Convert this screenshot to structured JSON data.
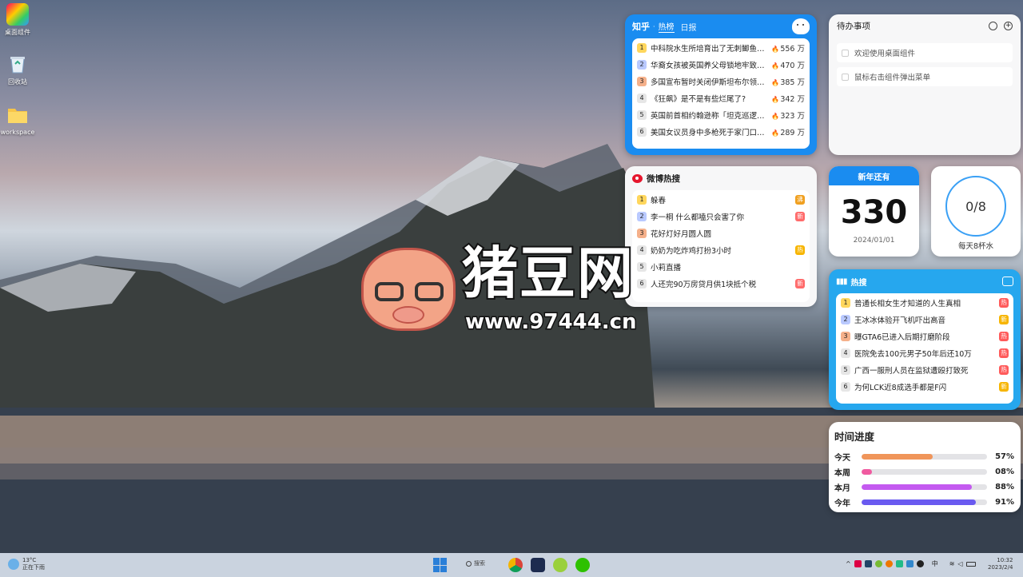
{
  "desktop": {
    "icons": [
      {
        "label": "桌面组件",
        "icon": "widget-app-icon"
      },
      {
        "label": "回收站",
        "icon": "recycle-bin-icon"
      },
      {
        "label": "workspace",
        "icon": "folder-icon"
      }
    ]
  },
  "zhihu": {
    "brand": "知乎",
    "tabs": [
      "热榜",
      "日报"
    ],
    "active_tab": "热榜",
    "items": [
      {
        "rank": "1",
        "title": "中科院水生所培育出了无刺鲫鱼，80...",
        "heat": "556 万"
      },
      {
        "rank": "2",
        "title": "华裔女孩被英国养父母锁地牢致役十...",
        "heat": "470 万"
      },
      {
        "rank": "3",
        "title": "多国宣布暂时关闭伊斯坦布尔领事馆...",
        "heat": "385 万"
      },
      {
        "rank": "4",
        "title": "《狂飙》是不是有些烂尾了?",
        "heat": "342 万"
      },
      {
        "rank": "5",
        "title": "英国前首相约翰逊称「坦克巡逻自己...",
        "heat": "323 万"
      },
      {
        "rank": "6",
        "title": "美国女议员身中多枪死于家门口，留...",
        "heat": "289 万"
      }
    ]
  },
  "todo": {
    "title": "待办事项",
    "items": [
      "欢迎使用桌面组件",
      "鼠标右击组件弹出菜单"
    ]
  },
  "weibo": {
    "title": "微博热搜",
    "items": [
      {
        "rank": "1",
        "title": "躲春",
        "tag": "沸",
        "tag_type": "fei"
      },
      {
        "rank": "2",
        "title": "李一桐 什么都嗑只会害了你",
        "tag": "新",
        "tag_type": "new"
      },
      {
        "rank": "3",
        "title": "花好灯好月圆人圆",
        "tag": "",
        "tag_type": ""
      },
      {
        "rank": "4",
        "title": "奶奶为吃炸鸡打扮3小时",
        "tag": "热",
        "tag_type": "jian"
      },
      {
        "rank": "5",
        "title": "小莉直播",
        "tag": "",
        "tag_type": ""
      },
      {
        "rank": "6",
        "title": "人还完90万房贷月供1块抵个税",
        "tag": "新",
        "tag_type": "new"
      }
    ]
  },
  "countdown": {
    "header": "新年还有",
    "days": "330",
    "date": "2024/01/01",
    "header_color": "#1a8cf0"
  },
  "water": {
    "value": "0/8",
    "caption": "每天8杯水",
    "ring_color": "#3aa0f5"
  },
  "douyin": {
    "title": "热搜",
    "items": [
      {
        "rank": "1",
        "title": "普通长相女生才知道的人生真相",
        "tag": "热",
        "tag_type": "hot"
      },
      {
        "rank": "2",
        "title": "王冰冰体验开飞机吓出高音",
        "tag": "新",
        "tag_type": "jian"
      },
      {
        "rank": "3",
        "title": "曝GTA6已进入后期打磨阶段",
        "tag": "热",
        "tag_type": "hot"
      },
      {
        "rank": "4",
        "title": "医院免去100元男子50年后还10万",
        "tag": "热",
        "tag_type": "hot"
      },
      {
        "rank": "5",
        "title": "广西一服刑人员在监狱遭殴打致死",
        "tag": "热",
        "tag_type": "hot"
      },
      {
        "rank": "6",
        "title": "为何LCK近8成选手都是F闪",
        "tag": "新",
        "tag_type": "jian"
      }
    ]
  },
  "progress": {
    "title": "时间进度",
    "rows": [
      {
        "label": "今天",
        "value": "57%",
        "fraction": 0.57,
        "color": "#f0955a"
      },
      {
        "label": "本周",
        "value": "08%",
        "fraction": 0.08,
        "color": "#f05aa0"
      },
      {
        "label": "本月",
        "value": "88%",
        "fraction": 0.88,
        "color": "#c45af0"
      },
      {
        "label": "今年",
        "value": "91%",
        "fraction": 0.91,
        "color": "#6a5af0"
      }
    ]
  },
  "taskbar": {
    "weather_temp": "13°C",
    "weather_desc": "正在下雨",
    "search_label": "搜索",
    "ime": "中",
    "time": "10:32",
    "date": "2023/2/4"
  },
  "watermark": {
    "title": "猪豆网",
    "url": "www.97444.cn"
  }
}
